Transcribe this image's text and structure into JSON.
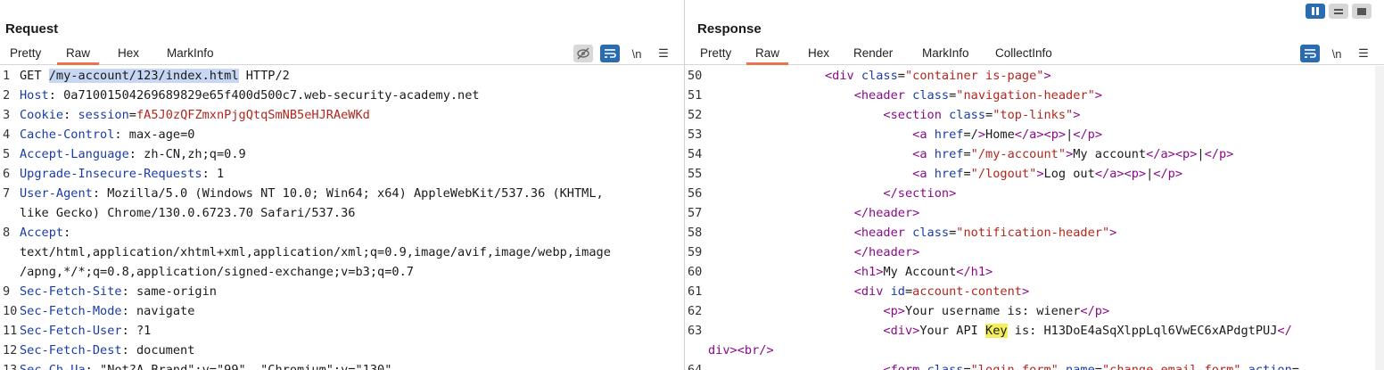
{
  "request": {
    "title": "Request",
    "tabs": [
      {
        "label": "Pretty",
        "active": false
      },
      {
        "label": "Raw",
        "active": true
      },
      {
        "label": "Hex",
        "active": false
      },
      {
        "label": "MarkInfo",
        "active": false
      }
    ],
    "newline_label": "\\n",
    "menu_icon": "☰",
    "lines": [
      {
        "n": "1",
        "parts": [
          {
            "t": "GET ",
            "c": "hv"
          },
          {
            "t": "/my-account/123/index.html",
            "c": "hl"
          },
          {
            "t": " HTTP/2",
            "c": "hv"
          }
        ]
      },
      {
        "n": "2",
        "parts": [
          {
            "t": "Host",
            "c": "hk"
          },
          {
            "t": ": 0a71001504269689829e65f400d500c7.web-security-academy.net",
            "c": "hv"
          }
        ]
      },
      {
        "n": "3",
        "parts": [
          {
            "t": "Cookie",
            "c": "hk"
          },
          {
            "t": ": ",
            "c": "hv"
          },
          {
            "t": "session",
            "c": "hk"
          },
          {
            "t": "=",
            "c": "hv"
          },
          {
            "t": "fA5J0zQFZmxnPjgQtqSmNB5eHJRAeWKd",
            "c": "red"
          }
        ]
      },
      {
        "n": "4",
        "parts": [
          {
            "t": "Cache-Control",
            "c": "hk"
          },
          {
            "t": ": max-age=0",
            "c": "hv"
          }
        ]
      },
      {
        "n": "5",
        "parts": [
          {
            "t": "Accept-Language",
            "c": "hk"
          },
          {
            "t": ": zh-CN,zh;q=0.9",
            "c": "hv"
          }
        ]
      },
      {
        "n": "6",
        "parts": [
          {
            "t": "Upgrade-Insecure-Requests",
            "c": "hk"
          },
          {
            "t": ": 1",
            "c": "hv"
          }
        ]
      },
      {
        "n": "7",
        "parts": [
          {
            "t": "User-Agent",
            "c": "hk"
          },
          {
            "t": ": Mozilla/5.0 (Windows NT 10.0; Win64; x64) AppleWebKit/537.36 (KHTML,",
            "c": "hv"
          }
        ]
      },
      {
        "n": "",
        "parts": [
          {
            "t": "like Gecko) Chrome/130.0.6723.70 Safari/537.36",
            "c": "hv"
          }
        ]
      },
      {
        "n": "8",
        "parts": [
          {
            "t": "Accept",
            "c": "hk"
          },
          {
            "t": ":",
            "c": "hv"
          }
        ]
      },
      {
        "n": "",
        "parts": [
          {
            "t": "text/html,application/xhtml+xml,application/xml;q=0.9,image/avif,image/webp,image",
            "c": "hv"
          }
        ]
      },
      {
        "n": "",
        "parts": [
          {
            "t": "/apng,*/*;q=0.8,application/signed-exchange;v=b3;q=0.7",
            "c": "hv"
          }
        ]
      },
      {
        "n": "9",
        "parts": [
          {
            "t": "Sec-Fetch-Site",
            "c": "hk"
          },
          {
            "t": ": same-origin",
            "c": "hv"
          }
        ]
      },
      {
        "n": "10",
        "parts": [
          {
            "t": "Sec-Fetch-Mode",
            "c": "hk"
          },
          {
            "t": ": navigate",
            "c": "hv"
          }
        ]
      },
      {
        "n": "11",
        "parts": [
          {
            "t": "Sec-Fetch-User",
            "c": "hk"
          },
          {
            "t": ": ?1",
            "c": "hv"
          }
        ]
      },
      {
        "n": "12",
        "parts": [
          {
            "t": "Sec-Fetch-Dest",
            "c": "hk"
          },
          {
            "t": ": document",
            "c": "hv"
          }
        ]
      },
      {
        "n": "13",
        "parts": [
          {
            "t": "Sec-Ch-Ua",
            "c": "hk"
          },
          {
            "t": ": \"Not?A_Brand\";v=\"99\", \"Chromium\";v=\"130\"",
            "c": "hv"
          }
        ]
      }
    ]
  },
  "response": {
    "title": "Response",
    "tabs": [
      {
        "label": "Pretty",
        "active": false
      },
      {
        "label": "Raw",
        "active": true
      },
      {
        "label": "Hex",
        "active": false
      },
      {
        "label": "Render",
        "active": false
      },
      {
        "label": "MarkInfo",
        "active": false
      },
      {
        "label": "CollectInfo",
        "active": false
      }
    ],
    "newline_label": "\\n",
    "menu_icon": "☰",
    "lines": [
      {
        "n": "50",
        "indent": "                ",
        "parts": [
          {
            "t": "<div ",
            "c": "tag"
          },
          {
            "t": "class",
            "c": "attr"
          },
          {
            "t": "=",
            "c": "txt"
          },
          {
            "t": "\"container is-page\"",
            "c": "val"
          },
          {
            "t": ">",
            "c": "tag"
          }
        ]
      },
      {
        "n": "51",
        "indent": "                    ",
        "parts": [
          {
            "t": "<header ",
            "c": "tag"
          },
          {
            "t": "class",
            "c": "attr"
          },
          {
            "t": "=",
            "c": "txt"
          },
          {
            "t": "\"navigation-header\"",
            "c": "val"
          },
          {
            "t": ">",
            "c": "tag"
          }
        ]
      },
      {
        "n": "52",
        "indent": "                        ",
        "parts": [
          {
            "t": "<section ",
            "c": "tag"
          },
          {
            "t": "class",
            "c": "attr"
          },
          {
            "t": "=",
            "c": "txt"
          },
          {
            "t": "\"top-links\"",
            "c": "val"
          },
          {
            "t": ">",
            "c": "tag"
          }
        ]
      },
      {
        "n": "53",
        "indent": "                            ",
        "parts": [
          {
            "t": "<a ",
            "c": "tag"
          },
          {
            "t": "href",
            "c": "attr"
          },
          {
            "t": "=/",
            "c": "txt"
          },
          {
            "t": ">",
            "c": "tag"
          },
          {
            "t": "Home",
            "c": "txt"
          },
          {
            "t": "</a><p>",
            "c": "tag"
          },
          {
            "t": "|",
            "c": "txt"
          },
          {
            "t": "</p>",
            "c": "tag"
          }
        ]
      },
      {
        "n": "54",
        "indent": "                            ",
        "parts": [
          {
            "t": "<a ",
            "c": "tag"
          },
          {
            "t": "href",
            "c": "attr"
          },
          {
            "t": "=",
            "c": "txt"
          },
          {
            "t": "\"/my-account\"",
            "c": "val"
          },
          {
            "t": ">",
            "c": "tag"
          },
          {
            "t": "My account",
            "c": "txt"
          },
          {
            "t": "</a><p>",
            "c": "tag"
          },
          {
            "t": "|",
            "c": "txt"
          },
          {
            "t": "</p>",
            "c": "tag"
          }
        ]
      },
      {
        "n": "55",
        "indent": "                            ",
        "parts": [
          {
            "t": "<a ",
            "c": "tag"
          },
          {
            "t": "href",
            "c": "attr"
          },
          {
            "t": "=",
            "c": "txt"
          },
          {
            "t": "\"/logout\"",
            "c": "val"
          },
          {
            "t": ">",
            "c": "tag"
          },
          {
            "t": "Log out",
            "c": "txt"
          },
          {
            "t": "</a><p>",
            "c": "tag"
          },
          {
            "t": "|",
            "c": "txt"
          },
          {
            "t": "</p>",
            "c": "tag"
          }
        ]
      },
      {
        "n": "56",
        "indent": "                        ",
        "parts": [
          {
            "t": "</section>",
            "c": "tag"
          }
        ]
      },
      {
        "n": "57",
        "indent": "                    ",
        "parts": [
          {
            "t": "</header>",
            "c": "tag"
          }
        ]
      },
      {
        "n": "58",
        "indent": "                    ",
        "parts": [
          {
            "t": "<header ",
            "c": "tag"
          },
          {
            "t": "class",
            "c": "attr"
          },
          {
            "t": "=",
            "c": "txt"
          },
          {
            "t": "\"notification-header\"",
            "c": "val"
          },
          {
            "t": ">",
            "c": "tag"
          }
        ]
      },
      {
        "n": "59",
        "indent": "                    ",
        "parts": [
          {
            "t": "</header>",
            "c": "tag"
          }
        ]
      },
      {
        "n": "60",
        "indent": "                    ",
        "parts": [
          {
            "t": "<h1>",
            "c": "tag"
          },
          {
            "t": "My Account",
            "c": "txt"
          },
          {
            "t": "</h1>",
            "c": "tag"
          }
        ]
      },
      {
        "n": "61",
        "indent": "                    ",
        "parts": [
          {
            "t": "<div ",
            "c": "tag"
          },
          {
            "t": "id",
            "c": "attr"
          },
          {
            "t": "=",
            "c": "txt"
          },
          {
            "t": "account-content",
            "c": "val"
          },
          {
            "t": ">",
            "c": "tag"
          }
        ]
      },
      {
        "n": "62",
        "indent": "                        ",
        "parts": [
          {
            "t": "<p>",
            "c": "tag"
          },
          {
            "t": "Your username is: wiener",
            "c": "txt"
          },
          {
            "t": "</p>",
            "c": "tag"
          }
        ]
      },
      {
        "n": "63",
        "indent": "                        ",
        "parts": [
          {
            "t": "<div>",
            "c": "tag"
          },
          {
            "t": "Your API ",
            "c": "txt"
          },
          {
            "t": "Key",
            "c": "key-hl"
          },
          {
            "t": " is: H13DoE4aSqXlppLql6VwEC6xAPdgtPUJ",
            "c": "txt"
          },
          {
            "t": "</",
            "c": "tag"
          }
        ]
      },
      {
        "n": "",
        "indent": "",
        "parts": [
          {
            "t": "div><br/>",
            "c": "tag"
          }
        ]
      },
      {
        "n": "64",
        "indent": "                        ",
        "parts": [
          {
            "t": "<form ",
            "c": "tag"
          },
          {
            "t": "class",
            "c": "attr"
          },
          {
            "t": "=",
            "c": "txt"
          },
          {
            "t": "\"login-form\"",
            "c": "val"
          },
          {
            "t": " ",
            "c": "txt"
          },
          {
            "t": "name",
            "c": "attr"
          },
          {
            "t": "=",
            "c": "txt"
          },
          {
            "t": "\"change-email-form\"",
            "c": "val"
          },
          {
            "t": " ",
            "c": "txt"
          },
          {
            "t": "action",
            "c": "attr"
          },
          {
            "t": "=",
            "c": "txt"
          }
        ]
      }
    ]
  }
}
